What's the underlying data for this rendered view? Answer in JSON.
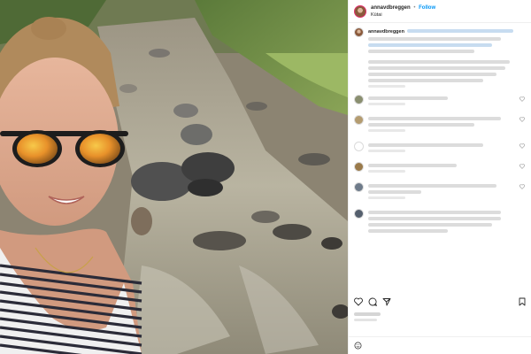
{
  "header": {
    "username": "annavdbreggen",
    "separator": "•",
    "follow_label": "Follow",
    "location": "Kütai"
  },
  "photo": {
    "description_icon": "selfie-river-photo"
  },
  "caption": {
    "username": "annavdbreggen"
  },
  "comments": [
    {
      "avatar": "avatar-icon"
    },
    {
      "avatar": "avatar-icon"
    },
    {
      "avatar": "avatar-icon"
    },
    {
      "avatar": "avatar-icon"
    },
    {
      "avatar": "avatar-icon"
    },
    {
      "avatar": "avatar-icon"
    }
  ],
  "actions": {
    "icons": [
      "heart-icon",
      "comment-icon",
      "share-icon",
      "bookmark-icon"
    ]
  },
  "add_comment": {
    "placeholder": "",
    "post_label": ""
  },
  "colors": {
    "accent": "#0095f6",
    "text": "#262626",
    "muted": "#8e8e8e"
  }
}
